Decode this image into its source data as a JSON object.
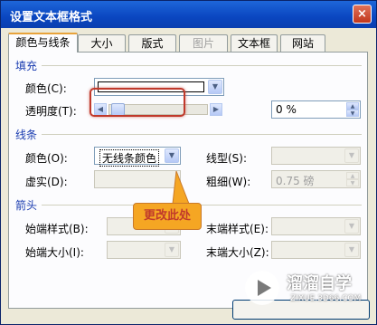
{
  "window": {
    "title": "设置文本框格式",
    "close_label": "×"
  },
  "tabs": [
    {
      "label": "颜色与线条"
    },
    {
      "label": "大小"
    },
    {
      "label": "版式"
    },
    {
      "label": "图片"
    },
    {
      "label": "文本框"
    },
    {
      "label": "网站"
    }
  ],
  "fill": {
    "section_label": "填充",
    "color_label": "颜色(C):",
    "color_value": "#ffffff",
    "transparency_label": "透明度(T):",
    "transparency_percent": 0,
    "transparency_value": "0 %"
  },
  "line": {
    "section_label": "线条",
    "color_label": "颜色(O):",
    "color_value": "无线条颜色",
    "linetype_label": "线型(S):",
    "dash_label": "虚实(D):",
    "weight_label": "粗细(W):",
    "weight_value": "0.75 磅"
  },
  "arrows": {
    "section_label": "箭头",
    "begin_style_label": "始端样式(B):",
    "end_style_label": "末端样式(E):",
    "begin_size_label": "始端大小(I):",
    "end_size_label": "末端大小(Z):"
  },
  "callout": {
    "text": "更改此处",
    "color": "#f5a623"
  },
  "watermark": {
    "brand": "溜溜自学",
    "url": "ZIXUE.3D66.COM"
  },
  "icons": {
    "close": "close-icon",
    "dropdown": "chevron-down-icon",
    "spin": "spin-arrows-icon",
    "watermark_logo": "play-logo-icon"
  }
}
